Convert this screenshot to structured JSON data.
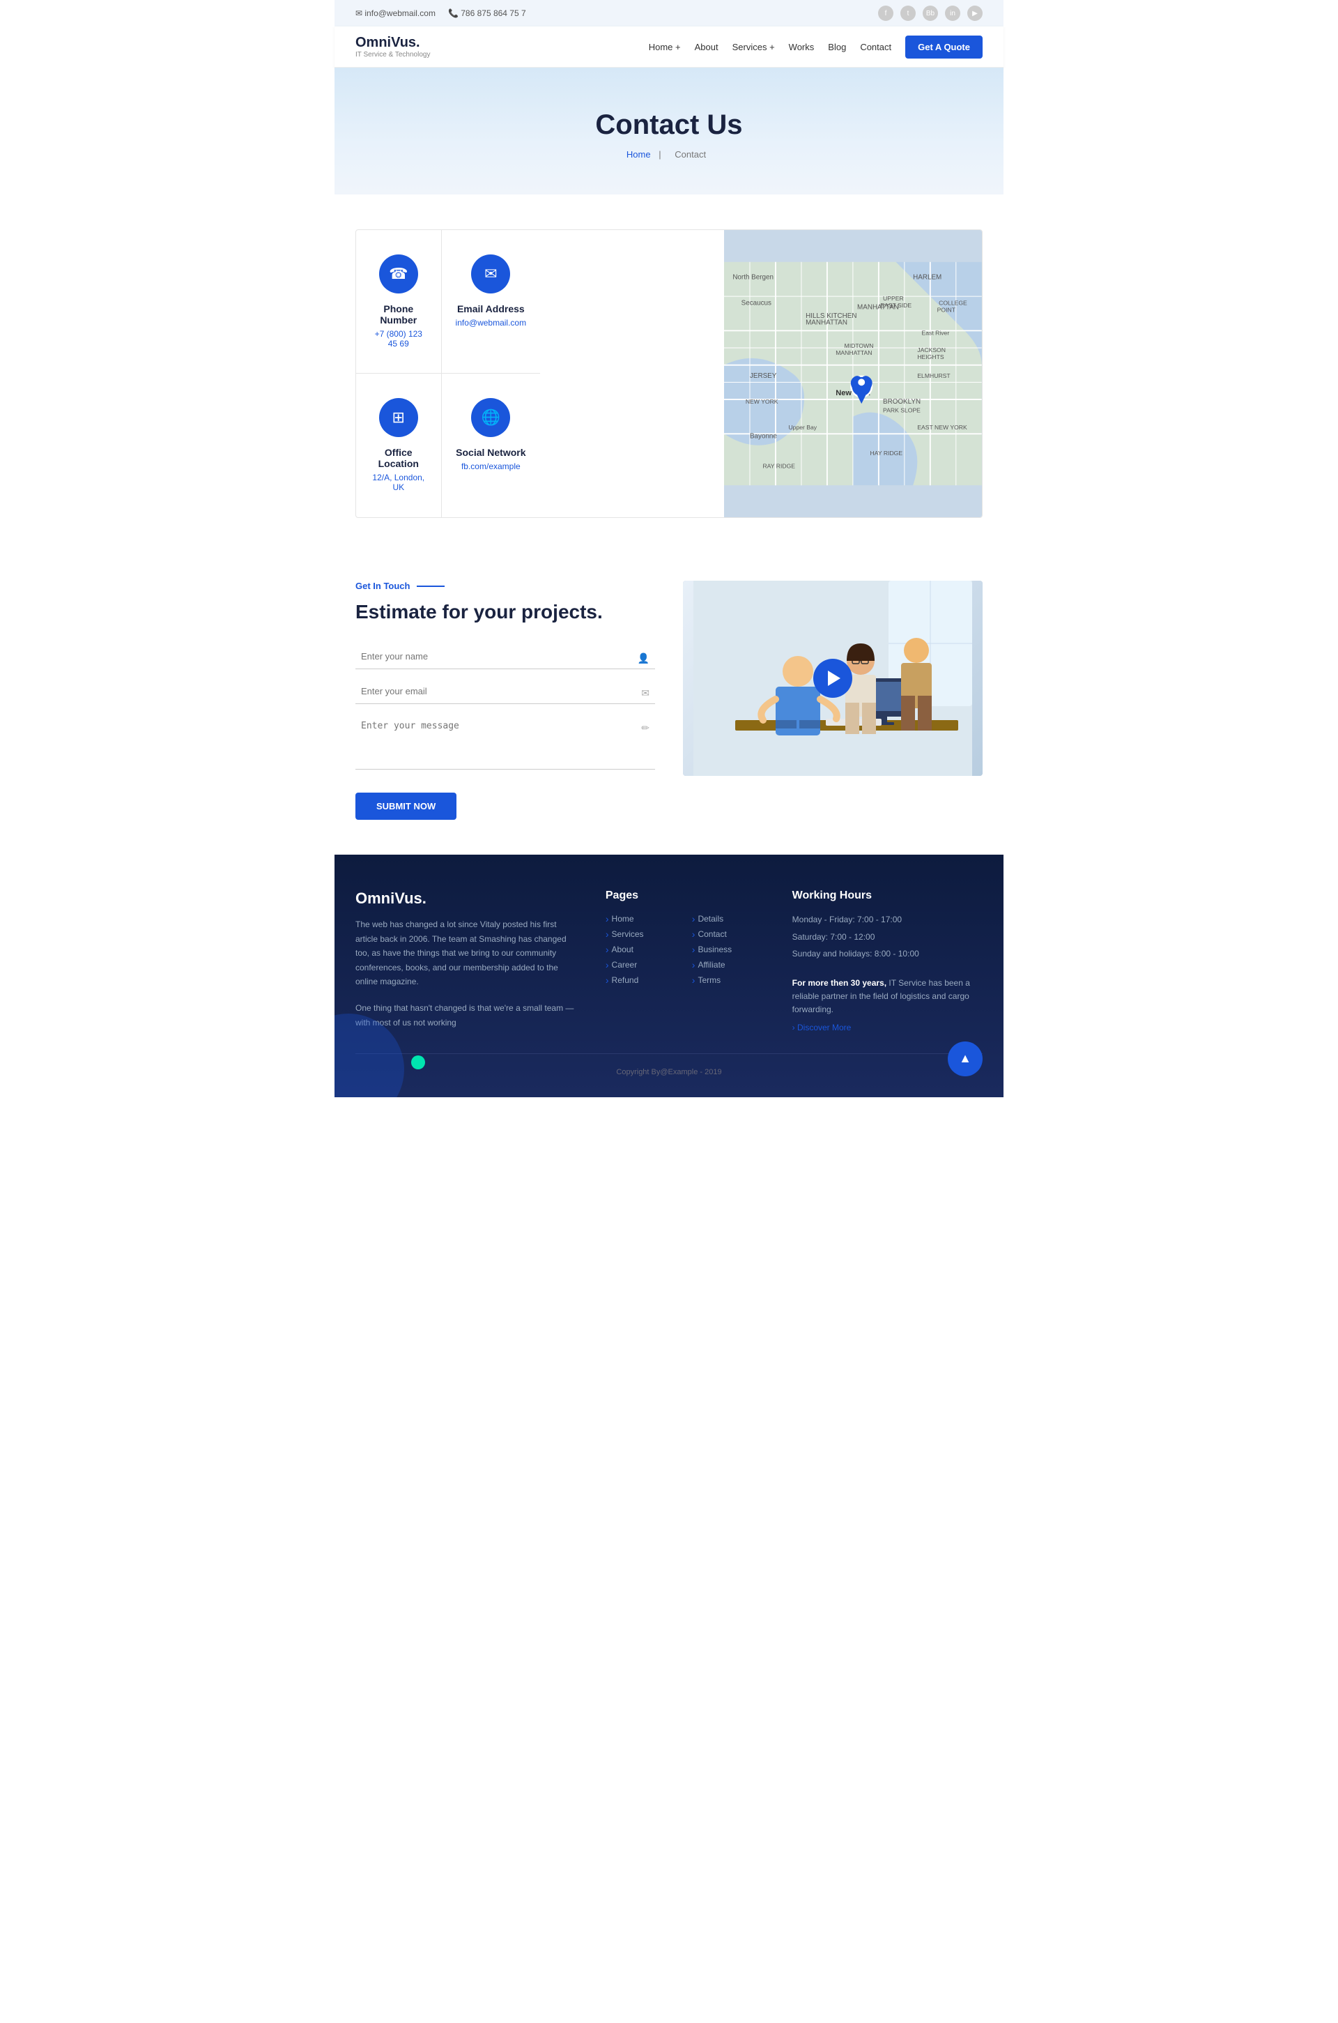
{
  "topbar": {
    "email": "info@webmail.com",
    "phone": "786 875 864 75 7",
    "social": [
      "f",
      "t",
      "Bb",
      "in",
      "▶"
    ]
  },
  "nav": {
    "logo_name": "OmniVus.",
    "logo_sub": "IT Service & Technology",
    "links": [
      "Home +",
      "About",
      "Services +",
      "Works",
      "Blog",
      "Contact"
    ],
    "cta": "Get A Quote"
  },
  "hero": {
    "title": "Contact Us",
    "breadcrumb_home": "Home",
    "separator": "|",
    "breadcrumb_current": "Contact"
  },
  "contact_cards": [
    {
      "icon": "☎",
      "title": "Phone Number",
      "value": "+7 (800) 123 45 69"
    },
    {
      "icon": "✉",
      "title": "Email Address",
      "value": "info@webmail.com"
    },
    {
      "icon": "⊞",
      "title": "Office Location",
      "value": "12/A, London, UK"
    },
    {
      "icon": "🌐",
      "title": "Social Network",
      "value": "fb.com/example"
    }
  ],
  "estimate": {
    "tag": "Get In Touch",
    "title": "Estimate for your projects.",
    "form": {
      "name_placeholder": "Enter your name",
      "email_placeholder": "Enter your email",
      "message_placeholder": "Enter your message",
      "submit_label": "Submit Now"
    }
  },
  "footer": {
    "logo": "OmniVus.",
    "description_1": "The web has changed a lot since Vitaly posted his first article back in 2006. The team at Smashing has changed too, as have the things that we bring to our community conferences, books, and our membership added to the online magazine.",
    "description_2": "One thing that hasn't changed is that we're a small team — with most of us not working",
    "pages_title": "Pages",
    "pages": [
      "Home",
      "Details",
      "Services",
      "Contact",
      "About",
      "Business",
      "Career",
      "Affiliate",
      "Refund",
      "Terms"
    ],
    "working_title": "Working Hours",
    "working_lines": [
      "Monday - Friday: 7:00 - 17:00",
      "Saturday: 7:00 - 12:00",
      "Sunday and holidays: 8:00 - 10:00"
    ],
    "working_highlight": "For more then 30 years,",
    "working_desc": " IT Service has been a reliable partner in the field of logistics and cargo forwarding.",
    "discover_more": "› Discover More",
    "copyright": "Copyright By@Example - 2019"
  }
}
